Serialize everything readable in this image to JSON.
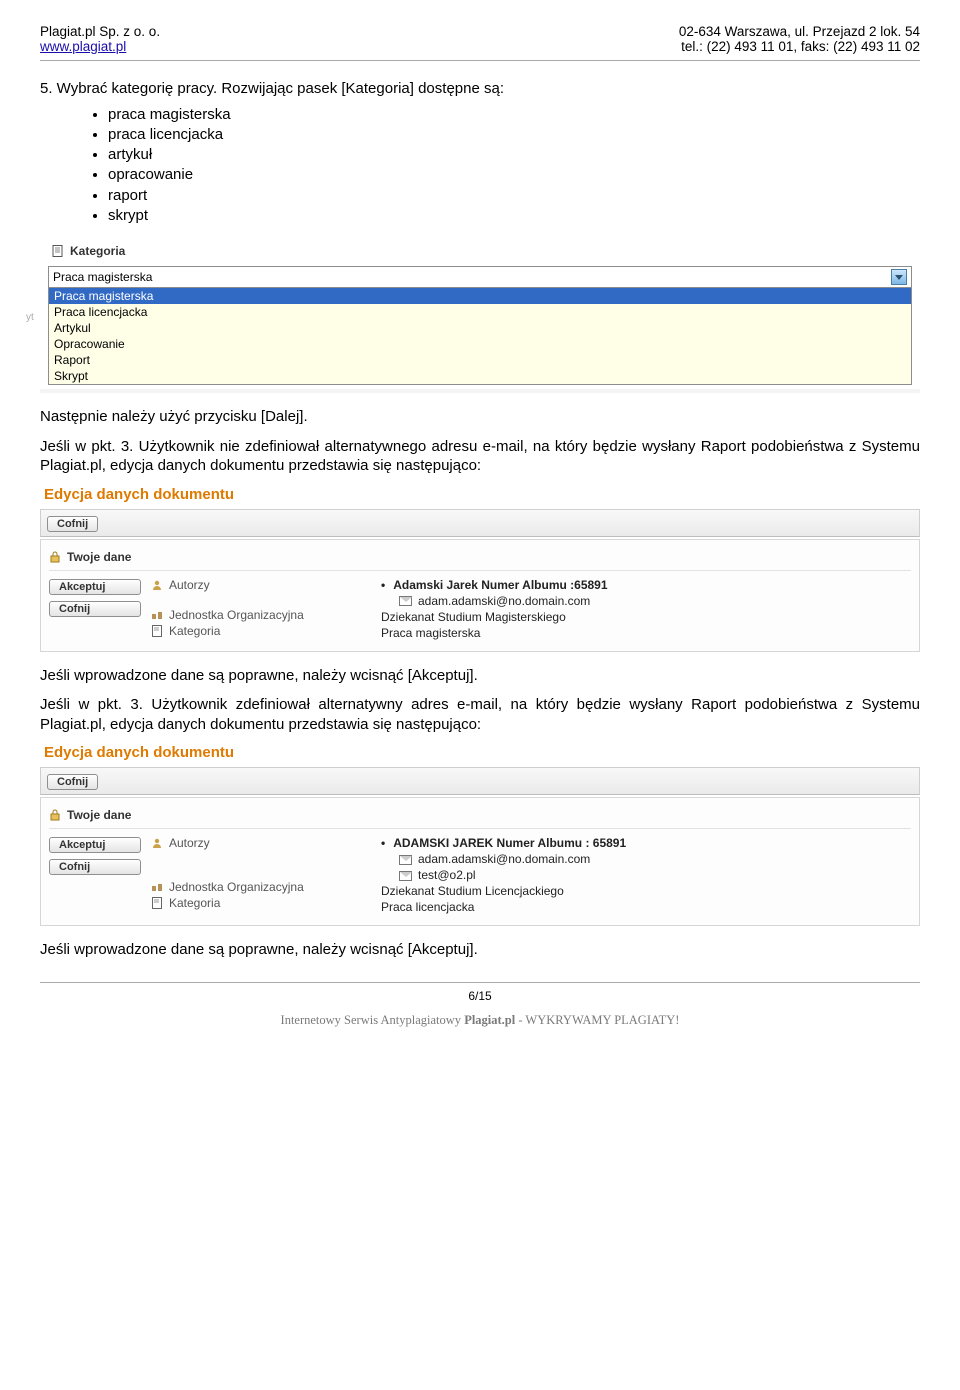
{
  "header": {
    "company": "Plagiat.pl Sp. z o. o.",
    "site": "www.plagiat.pl",
    "address": "02-634 Warszawa, ul. Przejazd 2 lok. 54",
    "phone": "tel.: (22) 493 11 01, faks: (22)  493 11 02"
  },
  "section5": {
    "lead": "5. Wybrać kategorię pracy. Rozwijając pasek [Kategoria] dostępne są:",
    "items": [
      "praca magisterska",
      "praca licencjacka",
      "artykuł",
      "opracowanie",
      "raport",
      "skrypt"
    ]
  },
  "kategoria_widget": {
    "label": "Kategoria",
    "selected": "Praca magisterska",
    "options": [
      "Praca magisterska",
      "Praca licencjacka",
      "Artykul",
      "Opracowanie",
      "Raport",
      "Skrypt"
    ],
    "sidenote": "yt"
  },
  "after1": "Następnie należy użyć przycisku [Dalej].",
  "para3a": "Jeśli w pkt. 3. Użytkownik nie zdefiniował alternatywnego adresu e-mail, na który będzie wysłany Raport podobieństwa z Systemu Plagiat.pl, edycja danych dokumentu przedstawia się następująco:",
  "edycja1": {
    "title": "Edycja danych dokumentu",
    "btn_cofnij": "Cofnij",
    "twoje_dane": "Twoje dane",
    "btn_akceptuj": "Akceptuj",
    "labels": {
      "autorzy": "Autorzy",
      "jednostka": "Jednostka Organizacyjna",
      "kategoria": "Kategoria"
    },
    "author_bold": "Adamski Jarek Numer Albumu :65891",
    "emails": [
      "adam.adamski@no.domain.com"
    ],
    "jednostka_val": "Dziekanat Studium Magisterskiego",
    "kategoria_val": "Praca magisterska"
  },
  "after2": "Jeśli wprowadzone dane są poprawne, należy wcisnąć [Akceptuj].",
  "para3b": "Jeśli w pkt. 3. Użytkownik zdefiniował alternatywny adres e-mail, na który będzie wysłany Raport podobieństwa z Systemu Plagiat.pl, edycja danych dokumentu przedstawia się następująco:",
  "edycja2": {
    "title": "Edycja danych dokumentu",
    "btn_cofnij": "Cofnij",
    "twoje_dane": "Twoje dane",
    "btn_akceptuj": "Akceptuj",
    "labels": {
      "autorzy": "Autorzy",
      "jednostka": "Jednostka Organizacyjna",
      "kategoria": "Kategoria"
    },
    "author_bold": "ADAMSKI JAREK Numer Albumu : 65891",
    "emails": [
      "adam.adamski@no.domain.com",
      "test@o2.pl"
    ],
    "jednostka_val": "Dziekanat Studium Licencjackiego",
    "kategoria_val": "Praca licencjacka"
  },
  "after3": "Jeśli wprowadzone dane są poprawne, należy wcisnąć [Akceptuj].",
  "footer": {
    "pagenum": "6/15",
    "line": "Internetowy Serwis Antyplagiatowy Plagiat.pl - WYKRYWAMY PLAGIATY!"
  }
}
